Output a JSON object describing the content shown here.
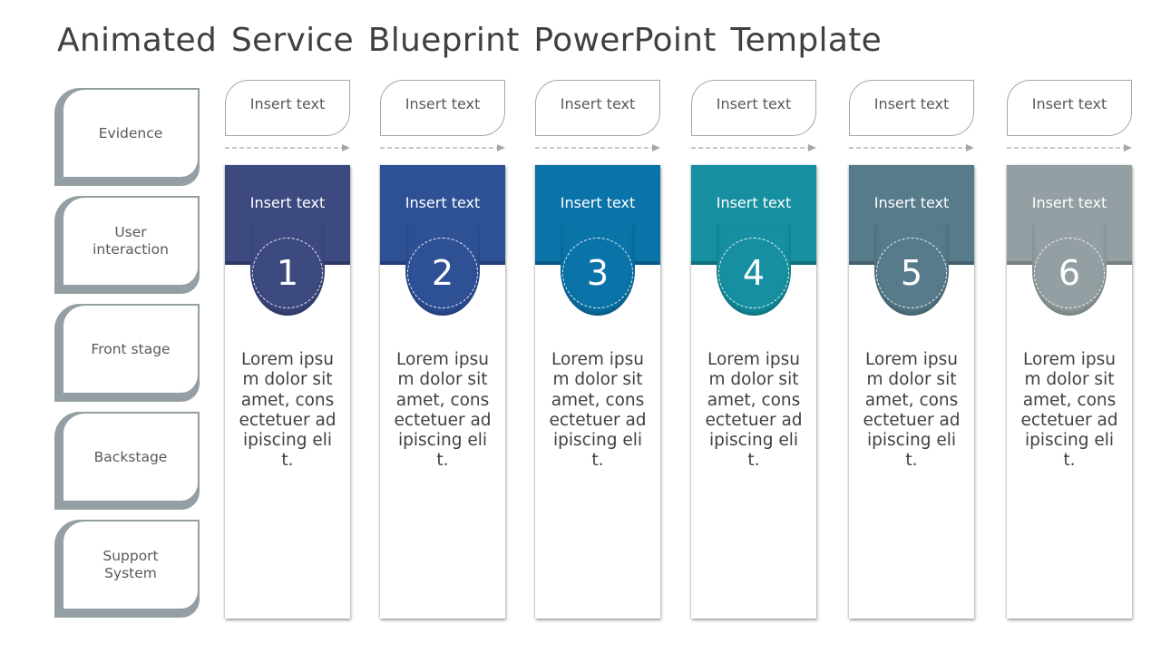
{
  "title": "Animated Service Blueprint PowerPoint Template",
  "row_labels": [
    {
      "label": "Evidence"
    },
    {
      "label": "User\ninteraction"
    },
    {
      "label": "Front stage"
    },
    {
      "label": "Backstage"
    },
    {
      "label": "Support\nSystem"
    }
  ],
  "columns": [
    {
      "evidence": "Insert text",
      "header": "Insert text",
      "number": "1",
      "color": "#3d4a80",
      "dark": "#2e3866",
      "body": "Lorem ipsum dolor sit amet, consectetuer adipiscing elit."
    },
    {
      "evidence": "Insert text",
      "header": "Insert text",
      "number": "2",
      "color": "#2e5196",
      "dark": "#223f78",
      "body": "Lorem ipsum dolor sit amet, consectetuer adipiscing elit."
    },
    {
      "evidence": "Insert text",
      "header": "Insert text",
      "number": "3",
      "color": "#0a73a8",
      "dark": "#075a85",
      "body": "Lorem ipsum dolor sit amet, consectetuer adipiscing elit."
    },
    {
      "evidence": "Insert text",
      "header": "Insert text",
      "number": "4",
      "color": "#1690a0",
      "dark": "#0f707d",
      "body": "Lorem ipsum dolor sit amet, consectetuer adipiscing elit."
    },
    {
      "evidence": "Insert text",
      "header": "Insert text",
      "number": "5",
      "color": "#577b8a",
      "dark": "#43606c",
      "body": "Lorem ipsum dolor sit amet, consectetuer adipiscing elit."
    },
    {
      "evidence": "Insert text",
      "header": "Insert text",
      "number": "6",
      "color": "#939fa2",
      "dark": "#75807f",
      "body": "Lorem ipsum dolor sit amet, consectetuer adipiscing elit."
    }
  ]
}
